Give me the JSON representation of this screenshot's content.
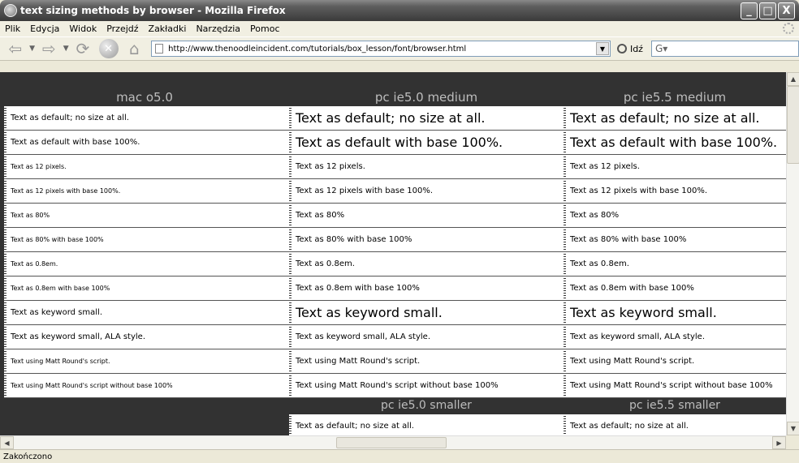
{
  "window": {
    "title": "text sizing methods by browser - Mozilla Firefox",
    "min": "_",
    "max": "□",
    "close": "X"
  },
  "menu": [
    "Plik",
    "Edycja",
    "Widok",
    "Przejdź",
    "Zakładki",
    "Narzędzia",
    "Pomoc"
  ],
  "toolbar": {
    "url": "http://www.thenoodleincident.com/tutorials/box_lesson/font/browser.html",
    "go_label": "Idź"
  },
  "columns": [
    {
      "header": "mac o5.0"
    },
    {
      "header": "pc ie5.0 medium"
    },
    {
      "header": "pc ie5.5 medium"
    }
  ],
  "rows": [
    "Text as default; no size at all.",
    "Text as default with base 100%.",
    "Text as 12 pixels.",
    "Text as 12 pixels with base 100%.",
    "Text as 80%",
    "Text as 80% with base 100%",
    "Text as 0.8em.",
    "Text as 0.8em with base 100%",
    "Text as keyword small.",
    "Text as keyword small, ALA style.",
    "Text using Matt Round's script.",
    "Text using Matt Round's script without base 100%"
  ],
  "section2": {
    "headers": [
      "pc ie5.0 smaller",
      "pc ie5.5 smaller"
    ],
    "first_row": "Text as default; no size at all."
  },
  "status": "Zakończono"
}
